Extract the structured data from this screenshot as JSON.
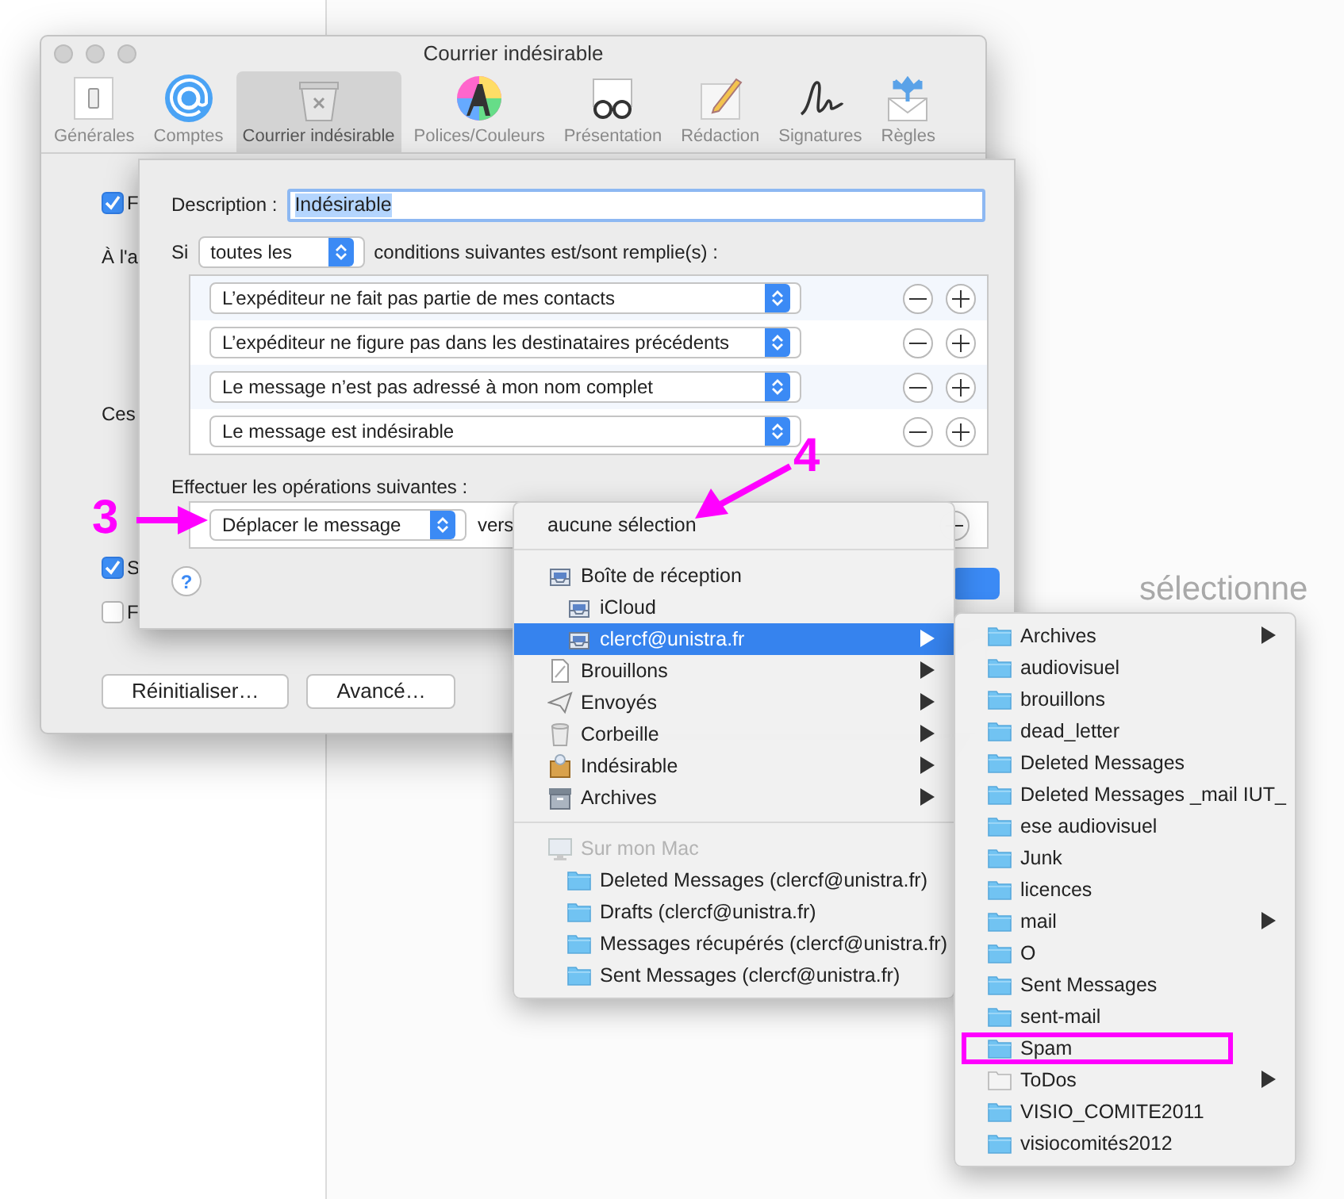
{
  "background": {
    "partial_text": "sélectionne"
  },
  "window": {
    "title": "Courrier indésirable"
  },
  "toolbar": [
    {
      "label": "Générales",
      "kind": "general",
      "selected": false
    },
    {
      "label": "Comptes",
      "kind": "accounts",
      "selected": false
    },
    {
      "label": "Courrier indésirable",
      "kind": "junk",
      "selected": true
    },
    {
      "label": "Polices/Couleurs",
      "kind": "fonts",
      "selected": false
    },
    {
      "label": "Présentation",
      "kind": "viewing",
      "selected": false
    },
    {
      "label": "Rédaction",
      "kind": "composing",
      "selected": false
    },
    {
      "label": "Signatures",
      "kind": "signatures",
      "selected": false
    },
    {
      "label": "Règles",
      "kind": "rules",
      "selected": false
    }
  ],
  "preferences": {
    "items": [
      {
        "kind": "checkbox",
        "label": "F",
        "checked": true
      },
      {
        "kind": "text",
        "label": "À l'a"
      },
      {
        "kind": "text",
        "label": "Ces"
      },
      {
        "kind": "checkbox",
        "label": "S",
        "checked": true
      },
      {
        "kind": "checkbox",
        "label": "F",
        "checked": false
      }
    ],
    "buttons": [
      "Réinitialiser…",
      "Avancé…"
    ]
  },
  "rule_sheet": {
    "description_label": "Description :",
    "description": "Indésirable",
    "if_label": "Si",
    "match_popup": "toutes les",
    "conditions_label": "conditions suivantes est/sont remplie(s) :",
    "conditions": [
      {
        "criterion": "L’expéditeur ne fait pas partie de mes contacts"
      },
      {
        "criterion": "L’expéditeur ne figure pas dans les destinataires précédents"
      },
      {
        "criterion": "Le message n’est pas adressé à mon nom complet"
      },
      {
        "criterion": "Le message est indésirable"
      }
    ],
    "actions_label": "Effectuer les opérations suivantes :",
    "action": {
      "popup": "Déplacer le message",
      "to_label": "vers"
    },
    "help": "?"
  },
  "mailbox_menu": {
    "items": [
      {
        "kind": "header",
        "label": "aucune sélection",
        "selected": false,
        "disabled": false,
        "has_submenu": false
      },
      {
        "kind": "separator"
      },
      {
        "kind": "inbox",
        "label": "Boîte de réception",
        "selected": false,
        "disabled": false,
        "has_submenu": false,
        "children": [
          {
            "kind": "inbox",
            "label": "iCloud",
            "selected": false,
            "disabled": false,
            "has_submenu": false
          },
          {
            "kind": "inbox",
            "label": "clercf@unistra.fr",
            "selected": true,
            "disabled": false,
            "has_submenu": true
          }
        ]
      },
      {
        "kind": "drafts",
        "label": "Brouillons",
        "selected": false,
        "disabled": false,
        "has_submenu": true
      },
      {
        "kind": "sent",
        "label": "Envoyés",
        "selected": false,
        "disabled": false,
        "has_submenu": true
      },
      {
        "kind": "trash",
        "label": "Corbeille",
        "selected": false,
        "disabled": false,
        "has_submenu": true
      },
      {
        "kind": "junk",
        "label": "Indésirable",
        "selected": false,
        "disabled": false,
        "has_submenu": true
      },
      {
        "kind": "archive",
        "label": "Archives",
        "selected": false,
        "disabled": false,
        "has_submenu": true
      },
      {
        "kind": "separator"
      },
      {
        "kind": "computer",
        "label": "Sur mon Mac",
        "selected": false,
        "disabled": true,
        "has_submenu": false,
        "children": [
          {
            "kind": "folder",
            "label": "Deleted Messages (clercf@unistra.fr)",
            "selected": false,
            "disabled": false,
            "has_submenu": false
          },
          {
            "kind": "folder",
            "label": "Drafts (clercf@unistra.fr)",
            "selected": false,
            "disabled": false,
            "has_submenu": false
          },
          {
            "kind": "folder",
            "label": "Messages récupérés (clercf@unistra.fr)",
            "selected": false,
            "disabled": false,
            "has_submenu": false
          },
          {
            "kind": "folder",
            "label": "Sent Messages (clercf@unistra.fr)",
            "selected": false,
            "disabled": false,
            "has_submenu": false
          }
        ]
      }
    ]
  },
  "submenu": {
    "items": [
      {
        "kind": "folder",
        "label": "Archives",
        "selected": false,
        "has_submenu": true
      },
      {
        "kind": "folder",
        "label": "audiovisuel",
        "selected": false,
        "has_submenu": false
      },
      {
        "kind": "folder",
        "label": "brouillons",
        "selected": false,
        "has_submenu": false
      },
      {
        "kind": "folder",
        "label": "dead_letter",
        "selected": false,
        "has_submenu": false
      },
      {
        "kind": "folder",
        "label": "Deleted Messages",
        "selected": false,
        "has_submenu": false
      },
      {
        "kind": "folder",
        "label": "Deleted Messages _mail IUT_",
        "selected": false,
        "has_submenu": false
      },
      {
        "kind": "folder",
        "label": "ese audiovisuel",
        "selected": false,
        "has_submenu": false
      },
      {
        "kind": "folder",
        "label": "Junk",
        "selected": false,
        "has_submenu": false
      },
      {
        "kind": "folder",
        "label": "licences",
        "selected": false,
        "has_submenu": false
      },
      {
        "kind": "folder",
        "label": "mail",
        "selected": false,
        "has_submenu": true
      },
      {
        "kind": "folder",
        "label": "O",
        "selected": false,
        "has_submenu": false
      },
      {
        "kind": "folder",
        "label": "Sent Messages",
        "selected": false,
        "has_submenu": false
      },
      {
        "kind": "folder",
        "label": "sent-mail",
        "selected": false,
        "has_submenu": false
      },
      {
        "kind": "folder",
        "label": "Spam",
        "selected": false,
        "has_submenu": false
      },
      {
        "kind": "plain",
        "label": "ToDos",
        "selected": false,
        "has_submenu": true
      },
      {
        "kind": "folder",
        "label": "VISIO_COMITE2011",
        "selected": false,
        "has_submenu": false
      },
      {
        "kind": "folder",
        "label": "visiocomités2012",
        "selected": false,
        "has_submenu": false
      }
    ]
  },
  "annotations": [
    {
      "kind": "step",
      "label": "3"
    },
    {
      "kind": "step",
      "label": "4"
    },
    {
      "kind": "highlight",
      "color": "#ff00ff"
    }
  ]
}
